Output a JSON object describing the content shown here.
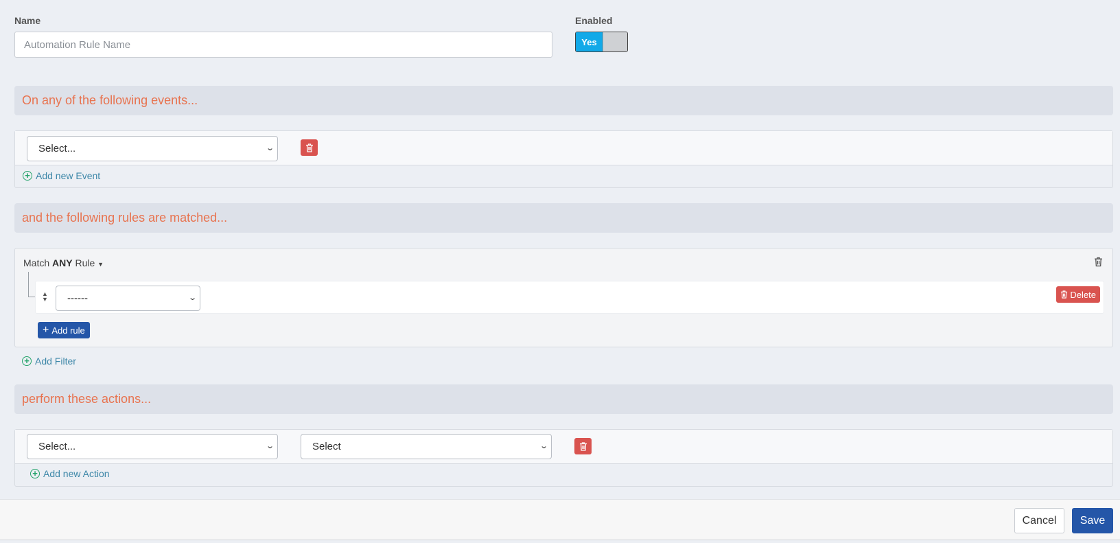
{
  "name_field": {
    "label": "Name",
    "placeholder": "Automation Rule Name",
    "value": ""
  },
  "enabled": {
    "label": "Enabled",
    "on_label": "Yes",
    "state": true
  },
  "events": {
    "heading": "On any of the following events...",
    "select_value": "Select...",
    "add_label": "Add new Event"
  },
  "rules": {
    "heading": "and the following rules are matched...",
    "match_prefix": "Match",
    "match_mode": "ANY",
    "match_suffix": "Rule",
    "rule_select_value": "------",
    "delete_label": "Delete",
    "add_rule_label": "Add rule",
    "add_filter_label": "Add Filter"
  },
  "actions": {
    "heading": "perform these actions...",
    "select_value": "Select...",
    "second_select_value": "Select",
    "add_label": "Add new Action"
  },
  "footer": {
    "cancel_label": "Cancel",
    "save_label": "Save"
  },
  "colors": {
    "accent_heading": "#e8734f",
    "primary": "#2456a8",
    "danger": "#d9534f",
    "toggle_on": "#12a9e8",
    "add_icon": "#24a36a"
  }
}
